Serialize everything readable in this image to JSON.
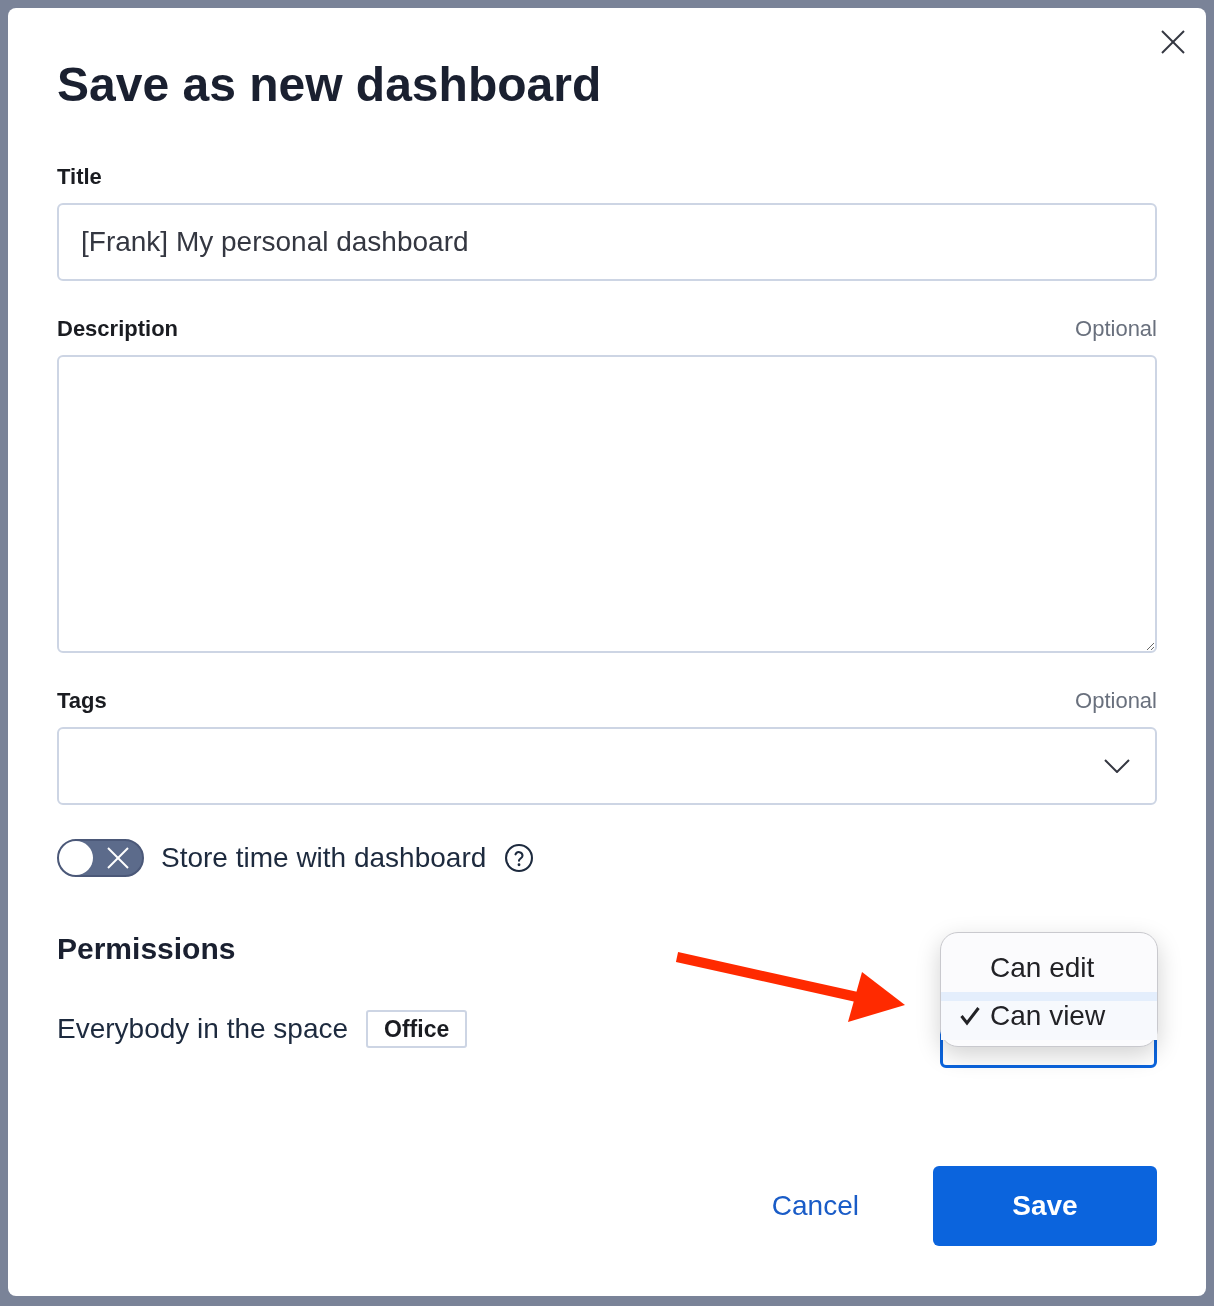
{
  "dialog": {
    "title": "Save as new dashboard"
  },
  "fields": [
    {
      "kind": "text",
      "label": "Title",
      "value": "[Frank] My personal dashboard"
    },
    {
      "kind": "textarea",
      "label": "Description",
      "optional_note": "Optional"
    },
    {
      "kind": "select",
      "label": "Tags",
      "optional_note": "Optional"
    }
  ],
  "store_time": {
    "label": "Store time with dashboard",
    "on": false
  },
  "permissions": {
    "heading": "Permissions",
    "audience": "Everybody in the space",
    "space": "Office",
    "access": {
      "focused": true,
      "expanded": true,
      "options": [
        {
          "label": "Can edit",
          "selected": false
        },
        {
          "label": "Can view",
          "selected": true
        }
      ]
    }
  },
  "buttons": [
    {
      "kind": "link",
      "label": "Cancel"
    },
    {
      "kind": "primary",
      "label": "Save"
    }
  ]
}
